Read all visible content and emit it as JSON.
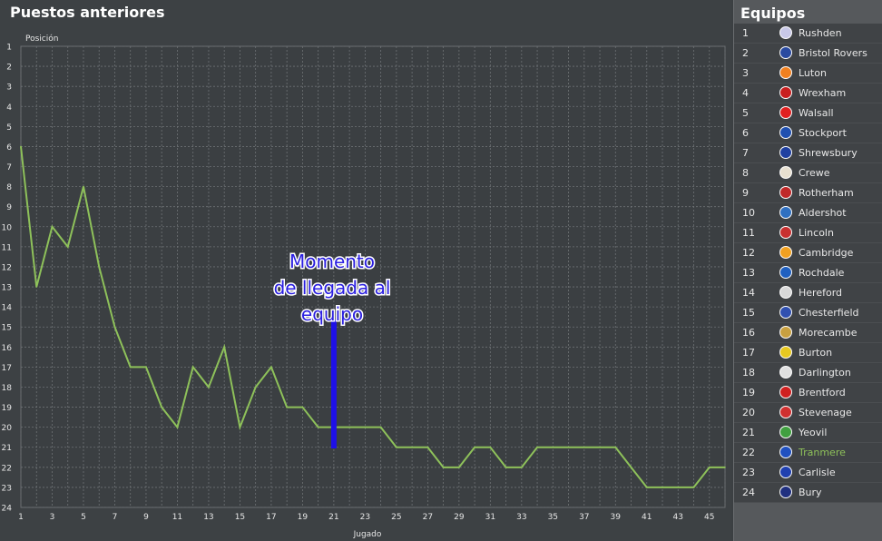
{
  "panel_title": "Puestos anteriores",
  "teams_title": "Equipos",
  "annotation": [
    "Momento",
    "de llegada al",
    "equipo"
  ],
  "colors": {
    "line": "#8ec15a",
    "marker": "#1e10e8",
    "highlight": "#8ec15a"
  },
  "chart_data": {
    "type": "line",
    "ylabel": "Posición",
    "xlabel": "Jugado",
    "ylim": [
      1,
      24
    ],
    "y_inverted": true,
    "xlim": [
      1,
      46
    ],
    "x_ticks": [
      1,
      3,
      5,
      7,
      9,
      11,
      13,
      15,
      17,
      19,
      21,
      23,
      25,
      27,
      29,
      31,
      33,
      35,
      37,
      39,
      41,
      43,
      45
    ],
    "y_ticks": [
      1,
      2,
      3,
      4,
      5,
      6,
      7,
      8,
      9,
      10,
      11,
      12,
      13,
      14,
      15,
      16,
      17,
      18,
      19,
      20,
      21,
      22,
      23,
      24
    ],
    "grid": true,
    "marker_x": 21,
    "x": [
      1,
      2,
      3,
      4,
      5,
      6,
      7,
      8,
      9,
      10,
      11,
      12,
      13,
      14,
      15,
      16,
      17,
      18,
      19,
      20,
      21,
      22,
      23,
      24,
      25,
      26,
      27,
      28,
      29,
      30,
      31,
      32,
      33,
      34,
      35,
      36,
      37,
      38,
      39,
      40,
      41,
      42,
      43,
      44,
      45,
      46
    ],
    "values": [
      6,
      13,
      10,
      11,
      8,
      12,
      15,
      17,
      17,
      19,
      20,
      17,
      18,
      16,
      20,
      18,
      17,
      19,
      19,
      20,
      20,
      20,
      20,
      20,
      21,
      21,
      21,
      22,
      22,
      21,
      21,
      22,
      22,
      21,
      21,
      21,
      21,
      21,
      21,
      22,
      23,
      23,
      23,
      23,
      22,
      22
    ]
  },
  "teams": [
    {
      "rank": "1",
      "name": "Rushden",
      "icon": "rushden-badge-icon",
      "color": "#c8c8e8"
    },
    {
      "rank": "2",
      "name": "Bristol Rovers",
      "icon": "bristol-rovers-badge-icon",
      "color": "#2a4aa0"
    },
    {
      "rank": "3",
      "name": "Luton",
      "icon": "luton-badge-icon",
      "color": "#f08020"
    },
    {
      "rank": "4",
      "name": "Wrexham",
      "icon": "wrexham-badge-icon",
      "color": "#c82020"
    },
    {
      "rank": "5",
      "name": "Walsall",
      "icon": "walsall-badge-icon",
      "color": "#e02020"
    },
    {
      "rank": "6",
      "name": "Stockport",
      "icon": "stockport-badge-icon",
      "color": "#2050b0"
    },
    {
      "rank": "7",
      "name": "Shrewsbury",
      "icon": "shrewsbury-badge-icon",
      "color": "#2040a0"
    },
    {
      "rank": "8",
      "name": "Crewe",
      "icon": "crewe-badge-icon",
      "color": "#e8e0d0"
    },
    {
      "rank": "9",
      "name": "Rotherham",
      "icon": "rotherham-badge-icon",
      "color": "#c02828"
    },
    {
      "rank": "10",
      "name": "Aldershot",
      "icon": "aldershot-badge-icon",
      "color": "#3070c0"
    },
    {
      "rank": "11",
      "name": "Lincoln",
      "icon": "lincoln-badge-icon",
      "color": "#c83030"
    },
    {
      "rank": "12",
      "name": "Cambridge",
      "icon": "cambridge-badge-icon",
      "color": "#f0a020"
    },
    {
      "rank": "13",
      "name": "Rochdale",
      "icon": "rochdale-badge-icon",
      "color": "#2060c0"
    },
    {
      "rank": "14",
      "name": "Hereford",
      "icon": "hereford-badge-icon",
      "color": "#d8d8d8"
    },
    {
      "rank": "15",
      "name": "Chesterfield",
      "icon": "chesterfield-badge-icon",
      "color": "#3050b0"
    },
    {
      "rank": "16",
      "name": "Morecambe",
      "icon": "morecambe-badge-icon",
      "color": "#c8a040"
    },
    {
      "rank": "17",
      "name": "Burton",
      "icon": "burton-badge-icon",
      "color": "#e8c820"
    },
    {
      "rank": "18",
      "name": "Darlington",
      "icon": "darlington-badge-icon",
      "color": "#e0e0e0"
    },
    {
      "rank": "19",
      "name": "Brentford",
      "icon": "brentford-badge-icon",
      "color": "#d02020"
    },
    {
      "rank": "20",
      "name": "Stevenage",
      "icon": "stevenage-badge-icon",
      "color": "#d03030"
    },
    {
      "rank": "21",
      "name": "Yeovil",
      "icon": "yeovil-badge-icon",
      "color": "#40a040"
    },
    {
      "rank": "22",
      "name": "Tranmere",
      "icon": "tranmere-badge-icon",
      "color": "#2050c0",
      "highlight": true
    },
    {
      "rank": "23",
      "name": "Carlisle",
      "icon": "carlisle-badge-icon",
      "color": "#2040b0"
    },
    {
      "rank": "24",
      "name": "Bury",
      "icon": "bury-badge-icon",
      "color": "#203080"
    }
  ]
}
